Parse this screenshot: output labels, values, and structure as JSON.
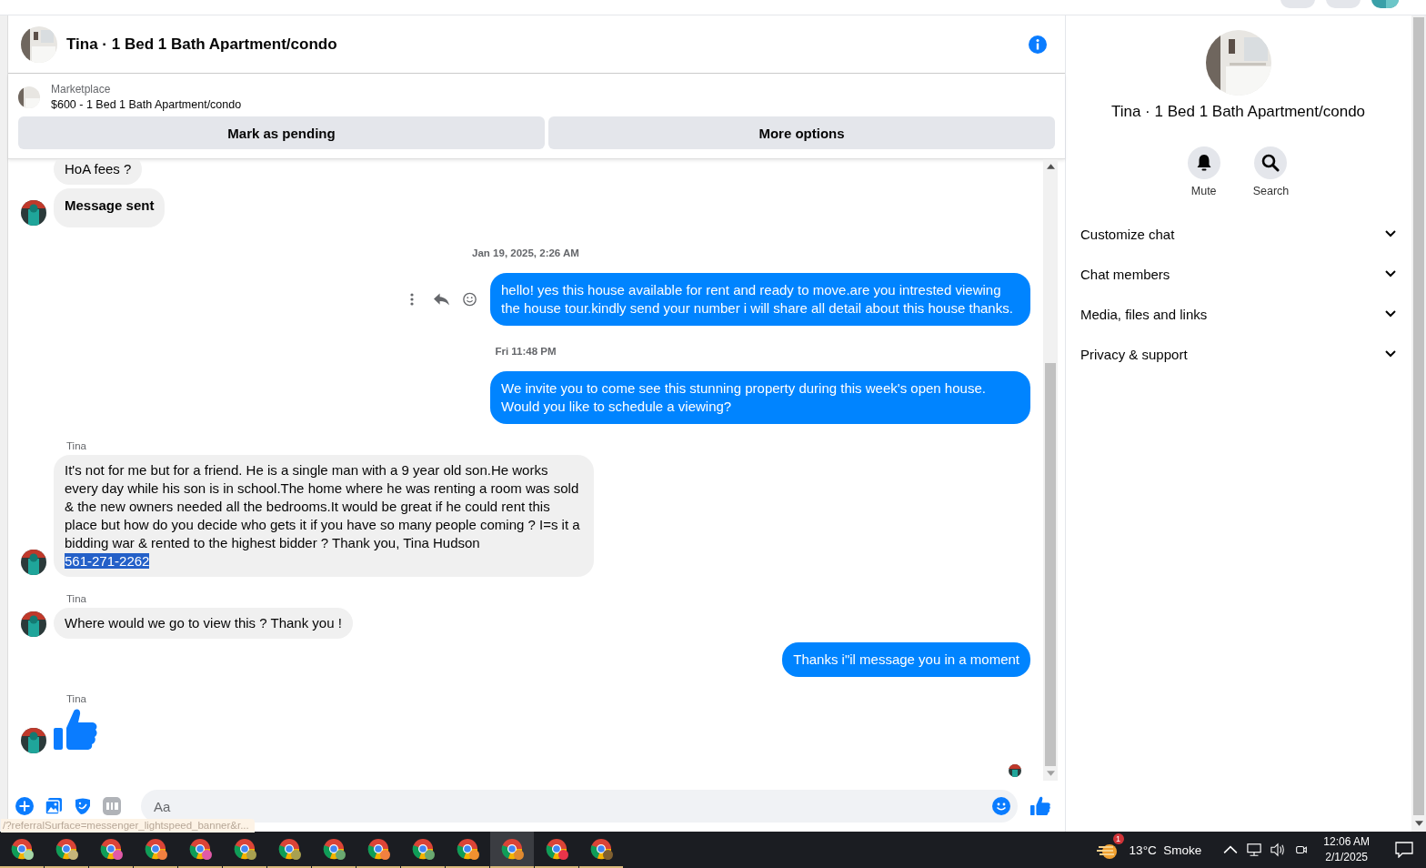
{
  "conversation": {
    "title": "Tina · 1 Bed 1 Bath Apartment/condo"
  },
  "listing": {
    "source": "Marketplace",
    "summary": "$600 - 1 Bed 1 Bath Apartment/condo",
    "buttons": [
      "Mark as pending",
      "More options"
    ]
  },
  "messages": [
    {
      "kind": "incoming",
      "text": "HoA fees ?"
    },
    {
      "kind": "incoming",
      "text": "Message sent",
      "bold": true
    },
    {
      "kind": "date",
      "text": "Jan 19, 2025, 2:26 AM"
    },
    {
      "kind": "outgoing",
      "text": "hello! yes this house available for rent and ready to move.are you intrested viewing the house tour.kindly send your number i will share all detail about this house thanks.",
      "actions": true
    },
    {
      "kind": "date",
      "text": "Fri 11:48 PM"
    },
    {
      "kind": "outgoing",
      "text": "We invite you to come see this stunning property during this week's open house. Would you like to schedule a viewing?"
    },
    {
      "kind": "incoming",
      "sender": "Tina",
      "text": "It's not for me but for a friend. He is a single man with a 9 year old son.He works every day while his son is in school.The home where he was renting a room was sold & the new owners needed all the bedrooms.It would be great if he could rent this place but how do you decide who gets it if you have so many people coming ? I=s it a bidding war & rented to the highest bidder ? Thank you, Tina Hudson",
      "selected_text": "561-271-2262"
    },
    {
      "kind": "incoming",
      "sender": "Tina",
      "text": "Where would we go to view this ? Thank you !"
    },
    {
      "kind": "outgoing",
      "text": "Thanks i\"il message you in a moment"
    },
    {
      "kind": "like",
      "sender": "Tina"
    }
  ],
  "composer": {
    "placeholder": "Aa"
  },
  "status_url": "/?referralSurface=messenger_lightspeed_banner&r...",
  "details": {
    "title": "Tina · 1 Bed 1 Bath Apartment/condo",
    "actions": [
      {
        "kind": "mute",
        "label": "Mute"
      },
      {
        "kind": "search",
        "label": "Search"
      }
    ],
    "sections": [
      {
        "label": "Customize chat",
        "expanded": false
      },
      {
        "label": "Chat members",
        "expanded": false
      },
      {
        "label": "Media, files and links",
        "expanded": false
      },
      {
        "label": "Privacy & support",
        "expanded": false
      }
    ]
  },
  "taskbar": {
    "apps": [
      {
        "color": "#a5d6a7",
        "selected": false
      },
      {
        "color": "#c5b57a",
        "selected": false
      },
      {
        "color": "#e05aa8",
        "selected": false
      },
      {
        "color": "#f08040",
        "selected": false
      },
      {
        "color": "#e05aa8",
        "selected": false
      },
      {
        "color": "#a8a050",
        "selected": false
      },
      {
        "color": "#a8a050",
        "selected": false
      },
      {
        "color": "#6aa870",
        "selected": false
      },
      {
        "color": "#f08040",
        "selected": false
      },
      {
        "color": "#6aa870",
        "selected": false
      },
      {
        "color": "#f09030",
        "selected": false
      },
      {
        "color": "#e08a30",
        "selected": true
      },
      {
        "color": "#e8344a",
        "selected": false
      },
      {
        "color": "#806030",
        "selected": false
      }
    ],
    "weather": "13°C  Smoke",
    "weather_badge": "1",
    "time": "12:06 AM",
    "date": "2/1/2025"
  }
}
